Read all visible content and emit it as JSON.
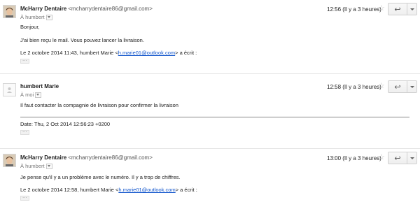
{
  "messages": [
    {
      "sender_name": "McHarry Dentaire",
      "sender_email": "<mcharrydentaire86@gmail.com>",
      "recipient": "À humbert",
      "time": "12:56 (Il y a 3 heures)",
      "greeting": "Bonjour,",
      "body": "J'ai bien reçu le mail. Vous pouvez lancer la livraison.",
      "quote_prefix": "Le 2 octobre 2014 11:43, humbert Marie <",
      "quote_link": "h.marie01@outlook.com",
      "quote_suffix": "> a écrit :",
      "dots": "..."
    },
    {
      "sender_name": "humbert Marie",
      "recipient": "À moi",
      "time": "12:58 (Il y a 3 heures)",
      "body": "Il faut contacter la compagnie de livraison pour confirmer la livraison",
      "date_line": "Date: Thu, 2 Oct 2014 12:56:23 +0200",
      "dots": "..."
    },
    {
      "sender_name": "McHarry Dentaire",
      "sender_email": "<mcharrydentaire86@gmail.com>",
      "recipient": "À humbert",
      "time": "13:00 (Il y a 3 heures)",
      "body": "Je pense qu'il y a un problème avec le numéro. Il y a trop de chiffres.",
      "quote_prefix": "Le 2 octobre 2014 12:58, humbert Marie <",
      "quote_link": "h.marie01@outlook.com",
      "quote_suffix": "> a écrit :",
      "dots": "..."
    }
  ],
  "icons": {
    "star": "☆",
    "reply": "↩",
    "avatar_photo": "person-photo-icon",
    "avatar_default": "default-avatar-icon"
  }
}
